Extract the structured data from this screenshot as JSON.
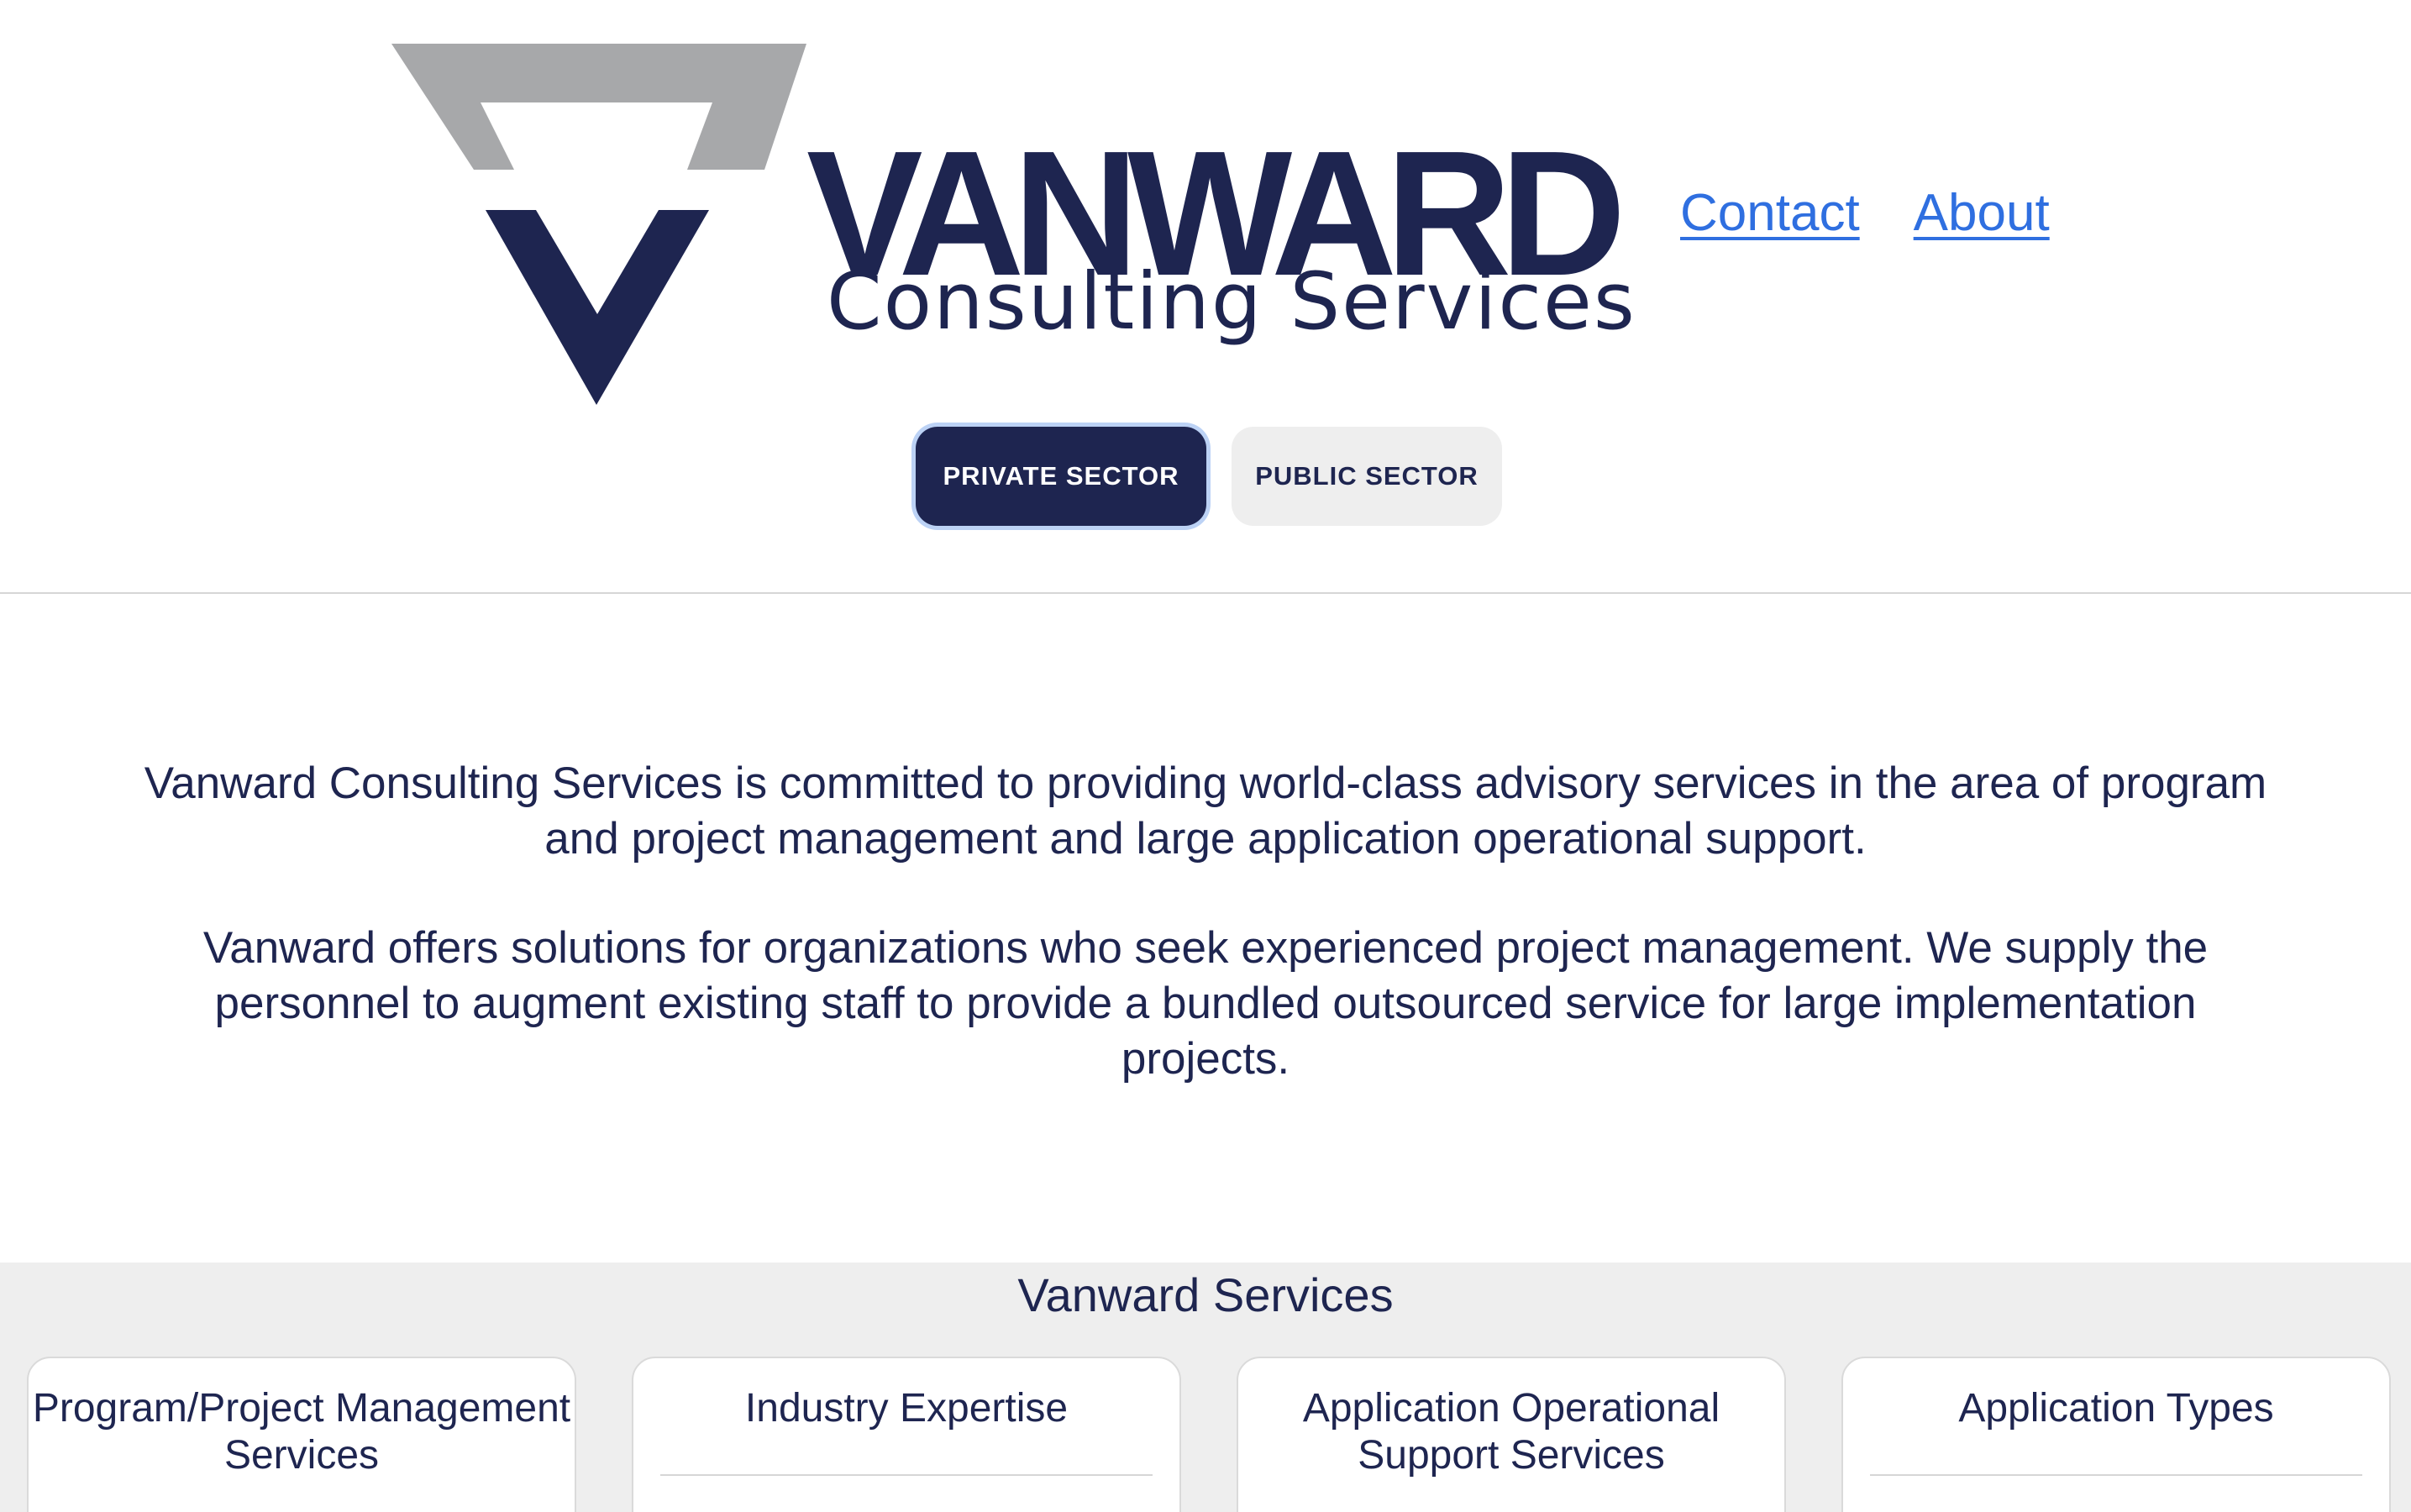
{
  "header": {
    "logo": {
      "wordmark": "VANWARD",
      "subtitle": "Consulting Services",
      "colors": {
        "navy": "#1e2550",
        "grey": "#a7a8aa"
      }
    },
    "nav": {
      "contact_label": "Contact",
      "about_label": "About"
    },
    "sector_tabs": [
      {
        "label": "PRIVATE SECTOR",
        "active": true
      },
      {
        "label": "PUBLIC SECTOR",
        "active": false
      }
    ]
  },
  "intro": {
    "paragraph_1": "Vanward Consulting Services is committed to providing world-class advisory services in the area of program and project management and large application operational support.",
    "paragraph_2": "Vanward offers solutions for organizations who seek experienced project management. We supply the personnel to augment existing staff to provide a bundled outsourced service for large implementation projects."
  },
  "services": {
    "title": "Vanward Services",
    "cards": [
      {
        "title": "Program/Project Management Services"
      },
      {
        "title": "Industry Expertise"
      },
      {
        "title": "Application Operational Support Services"
      },
      {
        "title": "Application Types"
      }
    ]
  },
  "colors": {
    "navy": "#1e2550",
    "link": "#2f6fe0",
    "active_tab_ring": "#bcd2f5",
    "section_bg": "#eeeeee"
  }
}
